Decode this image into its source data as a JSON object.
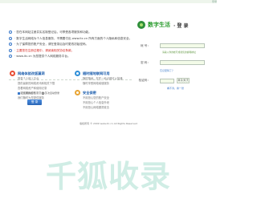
{
  "top_corner": "登录",
  "notes": [
    {
      "text": "· 您在本网站注册并实名制登记后，可享受各项服务和功能。",
      "red": false
    },
    {
      "text": "· 数字生活网络为个人信息服务，不需要付出 www.itc.cn 所有方面的个人隐私和信息安全。",
      "red": false
    },
    {
      "text": "· 为了保障您的账户安全，请在登录后及时更改初始密码。",
      "red": false
    },
    {
      "text": "· 主要您在注册过程中，请阅读相关协议条款。",
      "red": true
    },
    {
      "text": "· www.itc.cn 为您提供个人网络服务平台。",
      "red": false
    }
  ],
  "features": [
    {
      "title": "网络体验改版漏洞",
      "color": "#e84d35",
      "items": [
        "登录个人网上平台",
        "提供最新的网络资讯和相关下载",
        "查看网络资产和使用记录",
        "一站式便民生活服务中心",
        "我们随时为您提供服务"
      ]
    },
    {
      "title": "随时随地联网可用",
      "color": "#2f8fd8",
      "items": [
        "随时随地，在任一地点都可以接通",
        "随时享受网络增值服务"
      ]
    },
    {
      "title": "安全保密",
      "color": "#e8a535",
      "items": [
        "不用担心您的账户安全",
        "不用担心个人信息外泄",
        "不用担心网络漏洞攻击"
      ]
    }
  ],
  "login": {
    "brand": "数字生活",
    "subtitle": "· 登 录",
    "username_label": "帐 号：",
    "username_value": "",
    "username_hint": "请输入你的帐号或者您的邮箱地址",
    "password_label": "密 码：",
    "password_value": "",
    "forgot": "忘记密码了？",
    "captcha_label": "验证码：",
    "captcha_value": "",
    "captcha_image": "8 2 6 7",
    "refresh": "看不清，换一张",
    "remember": "记住我的帐号",
    "auto_login": "下次自动登录",
    "submit": "登 录"
  },
  "footer": "版权所有 © 2009 www.itc.cn All Rights Reserved",
  "watermark": "千狐收录"
}
